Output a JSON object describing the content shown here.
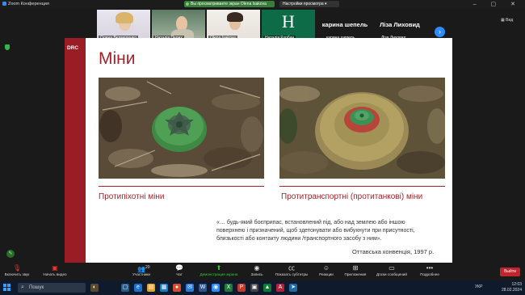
{
  "window": {
    "title": "Zoom Конференция"
  },
  "share": {
    "status": "Вы просматриваете экран Olena Isakova",
    "settings": "Настройки просмотра"
  },
  "view_label": "Вид",
  "participants": [
    {
      "name": "Олена Ведмеденко"
    },
    {
      "name": "Наталія Пелих"
    },
    {
      "name": "Olena Isakova"
    },
    {
      "name": "Наталія Корбич",
      "initial": "H"
    },
    {
      "name": "карина шепель",
      "display": "карина шепель"
    },
    {
      "name": "Ліза Лиховид",
      "display": "Ліза Лиховид"
    }
  ],
  "slide": {
    "logo": "DRC",
    "title": "Міни",
    "left_caption": "Протипіхотні міни",
    "right_caption": "Протитранспортні (протитанкові) міни",
    "quote": "«… будь-який боєприпас, встановлений під, або над землею або іншою поверхнею і призначений, щоб здетонувати або вибухнути при присутності, близькості або контакту людини /транспортного засобу з ним».",
    "source": "Оттавська конвенція, 1997 р."
  },
  "toolbar": {
    "mic": "Включить звук",
    "video": "Начать видео",
    "participants": "Участники",
    "participants_count": "20",
    "chat": "Чат",
    "share": "Демонстрация экрана",
    "record": "Запись",
    "cc": "Показать субтитры",
    "reactions": "Реакции",
    "apps": "Приложения",
    "whiteboards": "Доски сообщений",
    "more": "Подробнее",
    "exit": "Выйти"
  },
  "taskbar": {
    "search": "Пошук",
    "lang": "УКР",
    "time": "12:03",
    "date": "28.02.2024"
  },
  "colors": {
    "accent": "#9a1c24",
    "zoom_blue": "#2d8cff",
    "share_green": "#3a7c3a"
  }
}
